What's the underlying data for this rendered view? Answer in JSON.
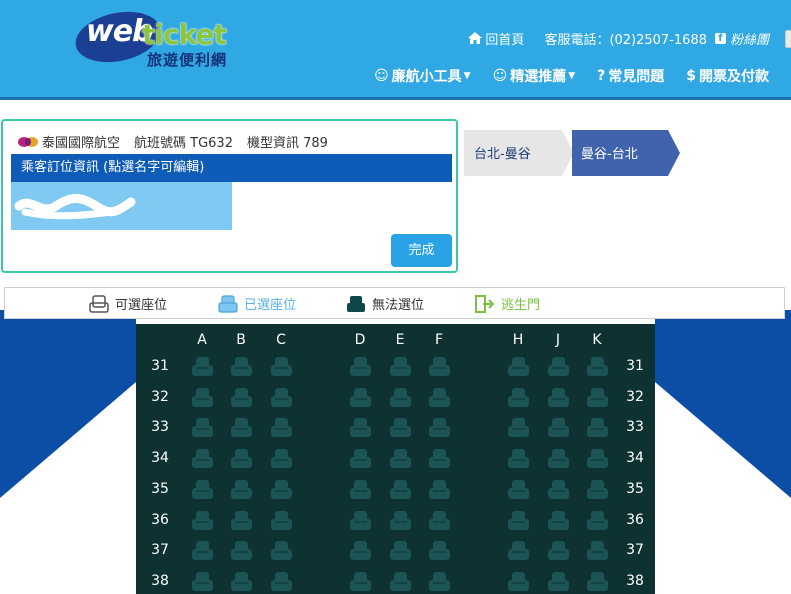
{
  "brand": {
    "web": "web",
    "ticket": "ticket",
    "subtitle": "旅遊便利網"
  },
  "top_links": {
    "home": "回首頁",
    "service": "客服電話：(02)2507-1688",
    "fans": "粉絲團"
  },
  "nav": [
    {
      "label": "廉航小工具",
      "icon": "smiley-icon",
      "dropdown": true
    },
    {
      "label": "精選推薦",
      "icon": "smiley-icon",
      "dropdown": true
    },
    {
      "label": "常見問題",
      "icon": "question-icon",
      "dropdown": false
    },
    {
      "label": "開票及付款",
      "icon": "dollar-icon",
      "dropdown": false
    }
  ],
  "flight": {
    "airline": "泰國國際航空",
    "flight_no": "航班號碼 TG632",
    "aircraft": "機型資訊 789"
  },
  "passenger": {
    "header": "乘客訂位資訊 (點選名字可編輯)",
    "done": "完成"
  },
  "legs": [
    {
      "label": "台北-曼谷",
      "active": false
    },
    {
      "label": "曼谷-台北",
      "active": true
    }
  ],
  "legend": [
    {
      "label": "可選座位",
      "state": "available"
    },
    {
      "label": "已選座位",
      "state": "selected"
    },
    {
      "label": "無法選位",
      "state": "unavailable"
    },
    {
      "label": "逃生門",
      "state": "exit"
    }
  ],
  "seat_map": {
    "columns": [
      "A",
      "B",
      "C",
      "D",
      "E",
      "F",
      "H",
      "J",
      "K"
    ],
    "rows": [
      "31",
      "32",
      "33",
      "34",
      "35",
      "36",
      "37",
      "38"
    ],
    "seat_state": "unavailable"
  },
  "colors": {
    "header": "#2fa8e4",
    "nav_rule": "#1d6fb3",
    "passenger_bar": "#0f5cb8",
    "active_leg": "#3f63ad",
    "inactive_leg": "#e6e6e6",
    "cabin_bg": "#0e3132",
    "seat_unavailable": "#1c5355",
    "fuselage": "#0c4ea6",
    "legend_selected": "#7cc6ef",
    "exit": "#7cc242"
  }
}
